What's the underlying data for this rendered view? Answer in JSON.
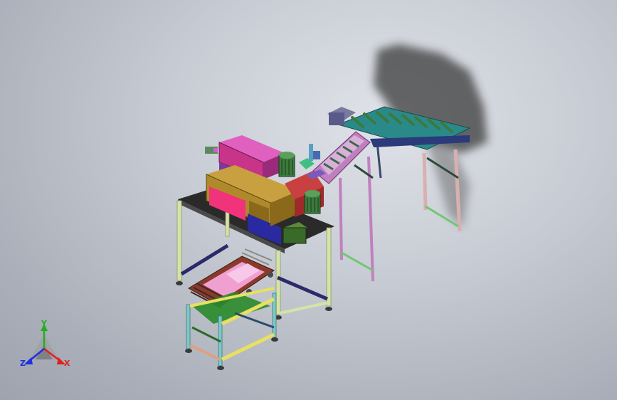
{
  "triad": {
    "x_label": "X",
    "y_label": "Y",
    "z_label": "Z",
    "x_color": "#e02020",
    "y_color": "#20b020",
    "z_color": "#2030e0"
  },
  "colors": {
    "background_center": "#dfe2e8",
    "background_edge": "#9ea3ad",
    "table_top": "#2a2a2a",
    "frame_leg": "#d6e3a8",
    "cabinet_magenta": "#c8348a",
    "cabinet_pink": "#f0337a",
    "cabinet_olive": "#b08a2a",
    "cabinet_purple": "#7a3aa0",
    "cabinet_blue": "#2a2aa0",
    "motor_green": "#3c7a3c",
    "conveyor_frame": "#c080c0",
    "conveyor_rollers": "#3a6a4a",
    "bin_pink": "#f0a0d0",
    "bin_brown": "#8a3a2a",
    "rail_yellow": "#e8e060",
    "rail_cyan": "#80c8c8",
    "rail_navy": "#2a2a6a",
    "shadow": "#3a3a3a"
  }
}
